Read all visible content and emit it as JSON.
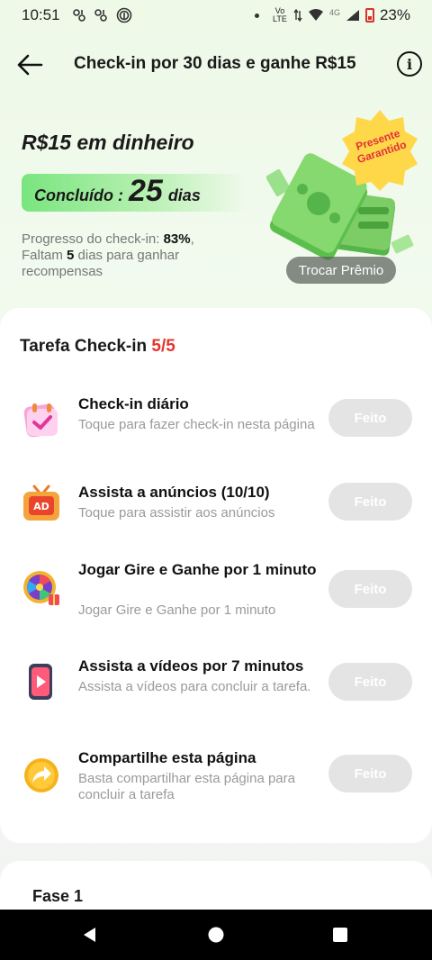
{
  "status_bar": {
    "time": "10:51",
    "network": "Vo LTE",
    "net_type": "4G",
    "battery": "23%"
  },
  "header": {
    "title": "Check-in por 30 dias e ganhe R$15"
  },
  "hero": {
    "reward_title": "R$15 em dinheiro",
    "done_label": "Concluído :",
    "days_done": "25",
    "days_unit": "dias",
    "progress_prefix": "Progresso do check-in: ",
    "progress_percent": "83%",
    "progress_mid": ", Faltam ",
    "days_left": "5",
    "progress_suffix": " dias para ganhar recompensas",
    "badge_line1": "Presente",
    "badge_line2": "Garantido",
    "swap_button": "Trocar Prêmio"
  },
  "tasks": {
    "title": "Tarefa Check-in ",
    "count": "5/5",
    "items": [
      {
        "title": "Check-in diário",
        "subtitle": "Toque para fazer check-in nesta página",
        "button": "Feito",
        "icon": "calendar-check-icon"
      },
      {
        "title": "Assista a anúncios  (10/10)",
        "subtitle": "Toque para assistir aos anúncios",
        "button": "Feito",
        "icon": "ad-tv-icon"
      },
      {
        "title": "Jogar Gire e Ganhe por 1 minuto",
        "subtitle": "Jogar Gire e Ganhe por 1 minuto",
        "button": "Feito",
        "icon": "spin-wheel-icon"
      },
      {
        "title": "Assista a vídeos por 7 minutos",
        "subtitle": "Assista a vídeos para concluir a tarefa.",
        "button": "Feito",
        "icon": "video-phone-icon"
      },
      {
        "title": "Compartilhe esta página",
        "subtitle": "Basta compartilhar esta página para concluir a tarefa",
        "button": "Feito",
        "icon": "share-arrow-icon"
      }
    ]
  },
  "phase": {
    "title": "Fase 1"
  },
  "colors": {
    "accent_red": "#e5342e",
    "green": "#79e57f",
    "button_done": "#e4e4e4"
  }
}
